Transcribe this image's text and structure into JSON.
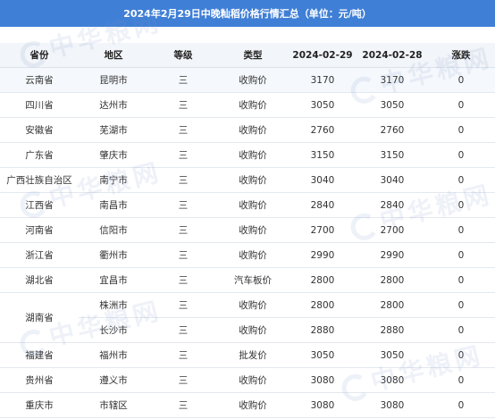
{
  "title": "2024年2月29日中晚籼稻价格行情汇总（单位：元/吨）",
  "watermark_text": "中华粮网",
  "table": {
    "headers": [
      "省份",
      "地区",
      "等级",
      "类型",
      "2024-02-29",
      "2024-02-28",
      "涨跌"
    ],
    "rows": [
      {
        "province": "云南省",
        "region": "昆明市",
        "grade": "三",
        "type": "收购价",
        "price_0229": "3170",
        "price_0228": "3170",
        "change": "0"
      },
      {
        "province": "四川省",
        "region": "达州市",
        "grade": "三",
        "type": "收购价",
        "price_0229": "3050",
        "price_0228": "3050",
        "change": "0"
      },
      {
        "province": "安徽省",
        "region": "芜湖市",
        "grade": "三",
        "type": "收购价",
        "price_0229": "2760",
        "price_0228": "2760",
        "change": "0"
      },
      {
        "province": "广东省",
        "region": "肇庆市",
        "grade": "三",
        "type": "收购价",
        "price_0229": "3150",
        "price_0228": "3150",
        "change": "0"
      },
      {
        "province": "广西壮族自治区",
        "region": "南宁市",
        "grade": "三",
        "type": "收购价",
        "price_0229": "3040",
        "price_0228": "3040",
        "change": "0"
      },
      {
        "province": "江西省",
        "region": "南昌市",
        "grade": "三",
        "type": "收购价",
        "price_0229": "2840",
        "price_0228": "2840",
        "change": "0"
      },
      {
        "province": "河南省",
        "region": "信阳市",
        "grade": "三",
        "type": "收购价",
        "price_0229": "2700",
        "price_0228": "2700",
        "change": "0"
      },
      {
        "province": "浙江省",
        "region": "衢州市",
        "grade": "三",
        "type": "收购价",
        "price_0229": "2990",
        "price_0228": "2990",
        "change": "0"
      },
      {
        "province": "湖北省",
        "region": "宜昌市",
        "grade": "三",
        "type": "汽车板价",
        "price_0229": "2800",
        "price_0228": "2800",
        "change": "0"
      },
      {
        "province": "湖南省",
        "region": "株洲市",
        "grade": "三",
        "type": "收购价",
        "price_0229": "2800",
        "price_0228": "2800",
        "change": "0"
      },
      {
        "province": "",
        "region": "长沙市",
        "grade": "三",
        "type": "收购价",
        "price_0229": "2880",
        "price_0228": "2880",
        "change": "0"
      },
      {
        "province": "福建省",
        "region": "福州市",
        "grade": "三",
        "type": "批发价",
        "price_0229": "3050",
        "price_0228": "3050",
        "change": "0"
      },
      {
        "province": "贵州省",
        "region": "遵义市",
        "grade": "三",
        "type": "收购价",
        "price_0229": "3080",
        "price_0228": "3080",
        "change": "0"
      },
      {
        "province": "重庆市",
        "region": "市辖区",
        "grade": "三",
        "type": "收购价",
        "price_0229": "3080",
        "price_0228": "3080",
        "change": "0"
      }
    ]
  },
  "colors": {
    "title_bg": "#3f7fd6",
    "header_bg": "#f2f5f9",
    "row_highlight": "#f5f8fc",
    "grid_line": "#e3e8ef"
  }
}
